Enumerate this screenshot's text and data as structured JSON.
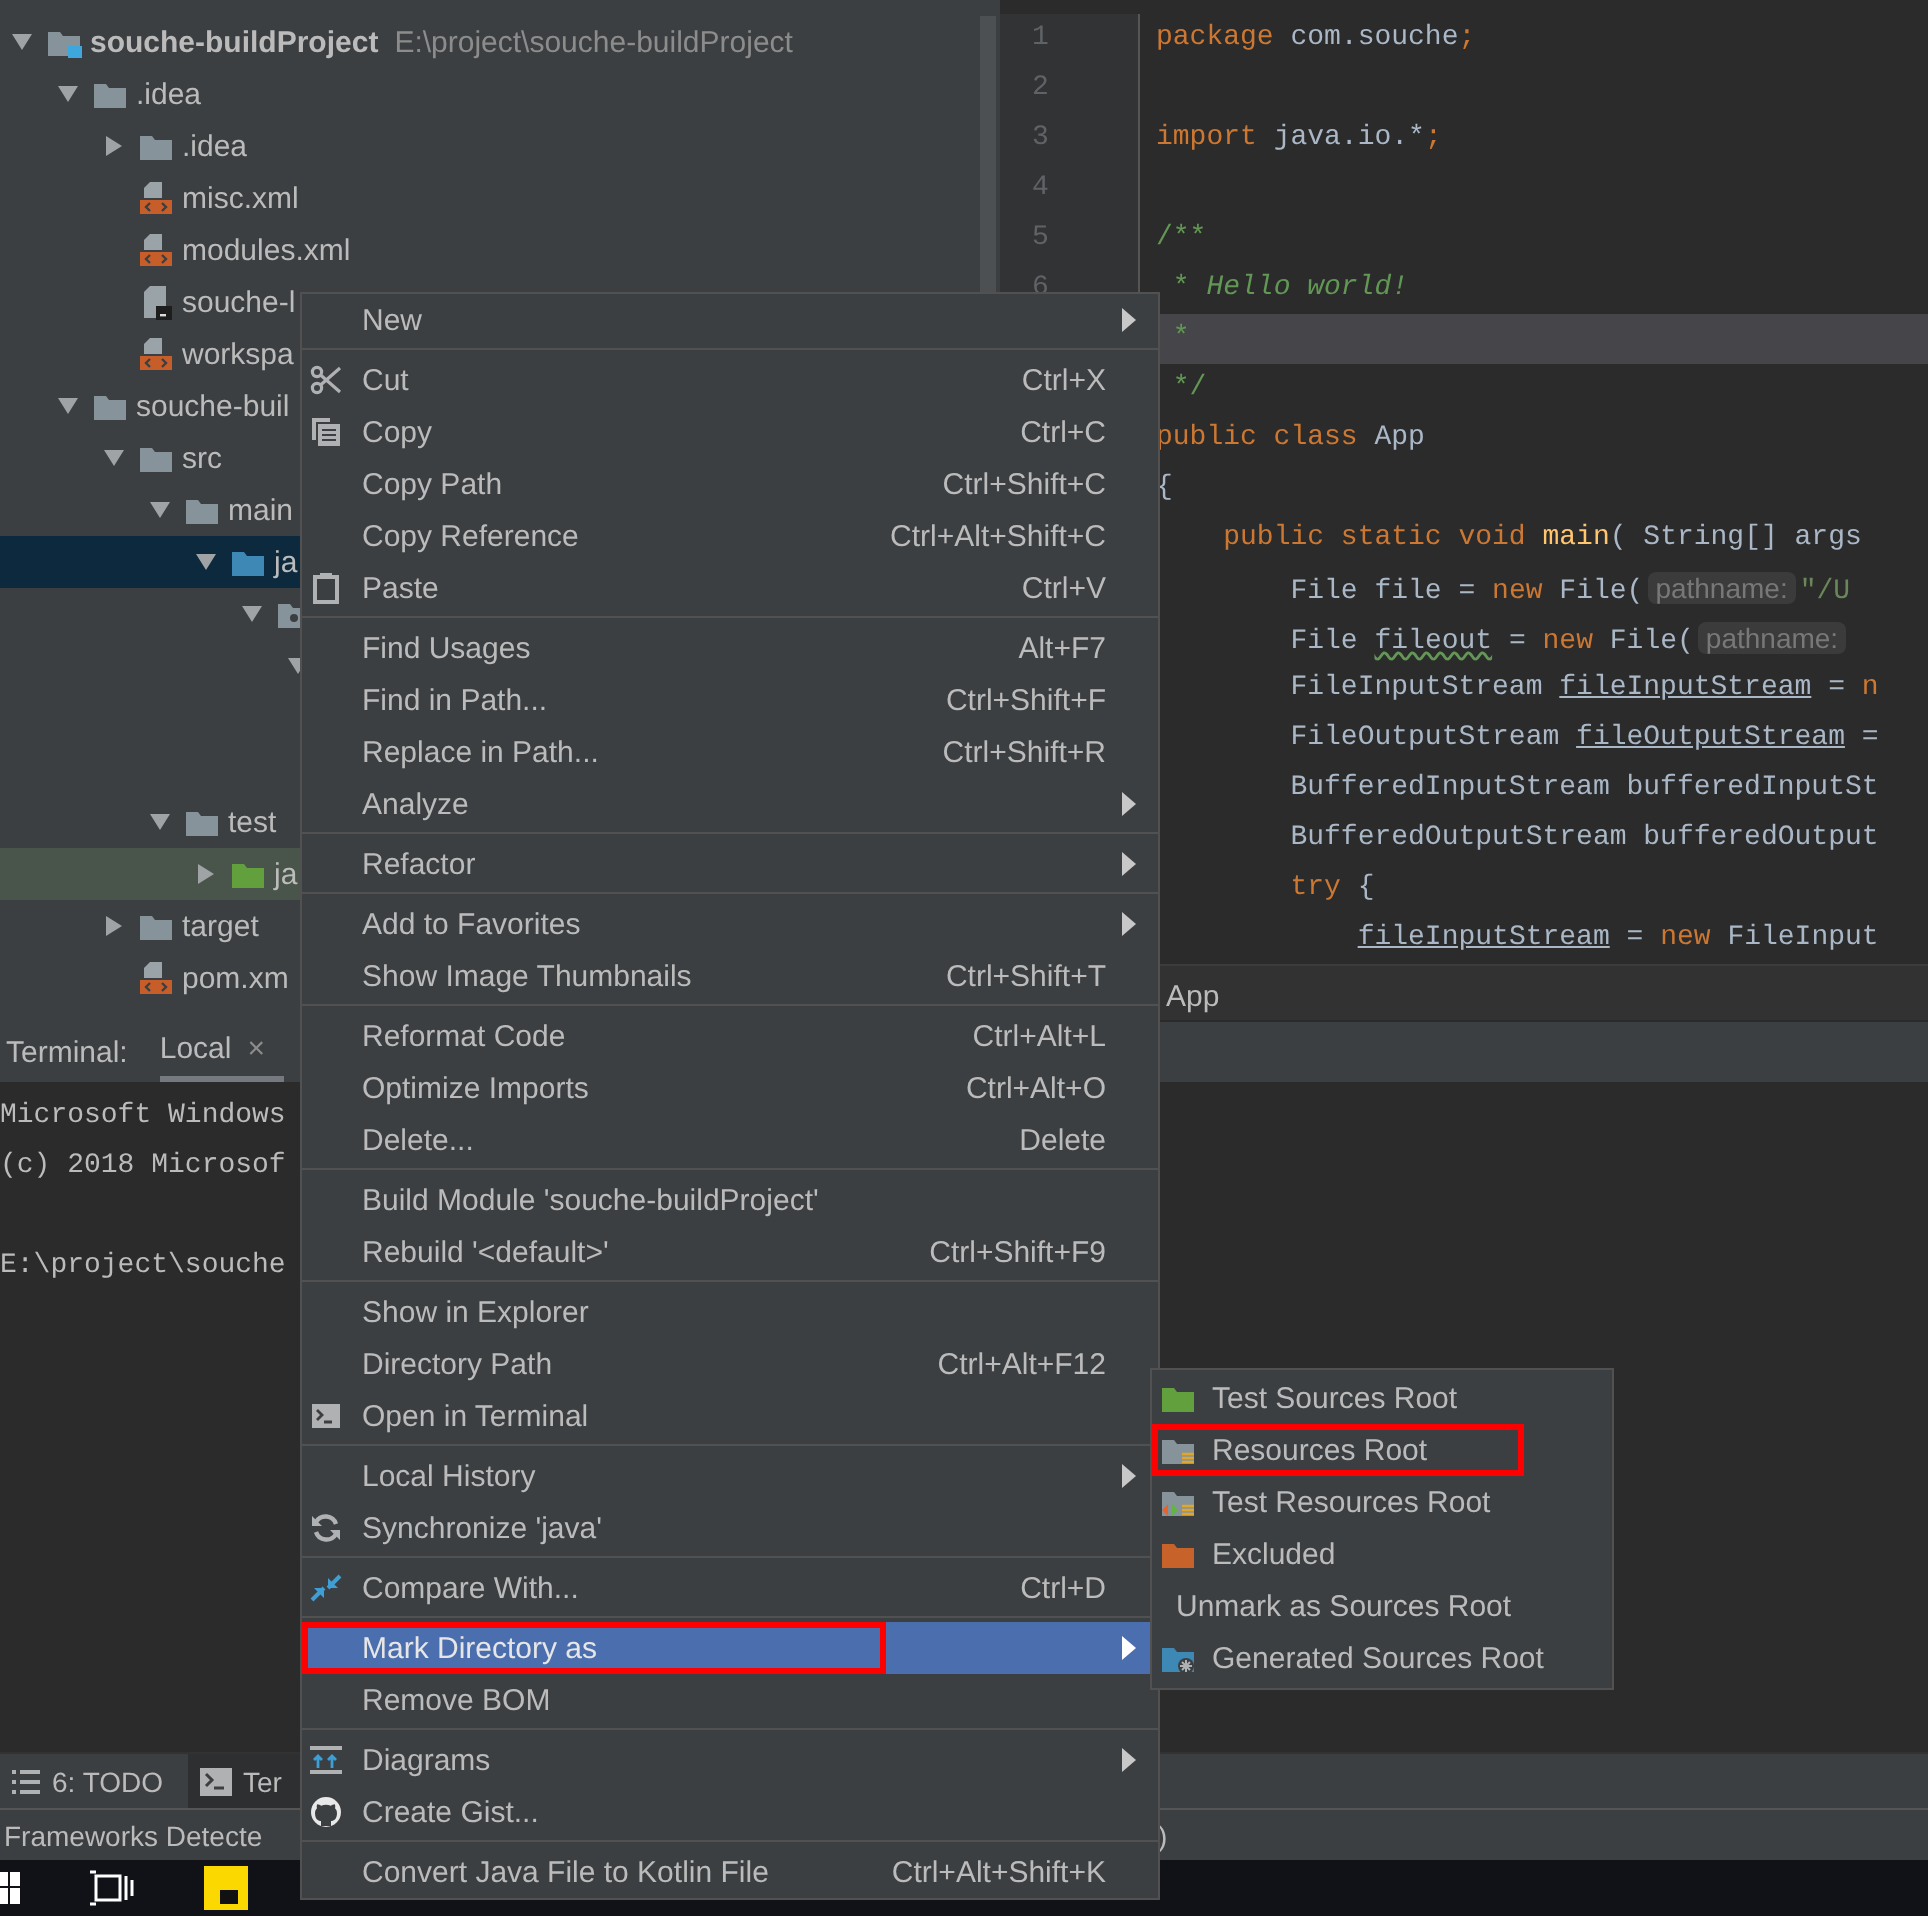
{
  "project_tree": [
    {
      "label": "souche-buildProject",
      "path": "E:\\project\\souche-buildProject",
      "kind": "module",
      "expanded": true,
      "selected": false,
      "children": [
        {
          "label": ".idea",
          "kind": "folder",
          "expanded": true,
          "selected": false,
          "children": [
            {
              "label": ".idea",
              "kind": "folder",
              "expanded": false,
              "selected": false
            },
            {
              "label": "misc.xml",
              "kind": "xml",
              "selected": false
            },
            {
              "label": "modules.xml",
              "kind": "xml",
              "selected": false
            },
            {
              "label": "souche-l",
              "kind": "iml",
              "selected": false
            },
            {
              "label": "workspa",
              "kind": "xml",
              "selected": false
            }
          ]
        },
        {
          "label": "souche-buil",
          "kind": "folder",
          "expanded": true,
          "selected": false,
          "children": [
            {
              "label": "src",
              "kind": "folder",
              "expanded": true,
              "selected": false,
              "children": [
                {
                  "label": "main",
                  "kind": "folder",
                  "expanded": true,
                  "selected": false,
                  "children": [
                    {
                      "label": "ja",
                      "kind": "sources",
                      "expanded": true,
                      "selected": true,
                      "children": [
                        {
                          "kind": "package",
                          "expanded": true,
                          "selected": false,
                          "children": [
                            {
                              "expanded": true,
                              "selected": false
                            }
                          ]
                        }
                      ]
                    }
                  ]
                },
                {
                  "label": "test",
                  "kind": "folder",
                  "expanded": true,
                  "selected": false,
                  "children": [
                    {
                      "label": "ja",
                      "kind": "test-sources",
                      "expanded": false,
                      "selected": false
                    }
                  ]
                }
              ]
            },
            {
              "label": "target",
              "kind": "folder",
              "expanded": false,
              "selected": false
            },
            {
              "label": "pom.xm",
              "kind": "xml",
              "selected": false
            }
          ]
        }
      ]
    }
  ],
  "editor": {
    "lines": [
      {
        "number": "1",
        "current": false,
        "tokens": [
          {
            "kind": "keyword",
            "text": "package"
          },
          {
            "kind": "plain",
            "text": " com.souche"
          },
          {
            "kind": "keyword",
            "text": ";"
          }
        ]
      },
      {
        "number": "2",
        "current": false
      },
      {
        "number": "3",
        "current": false,
        "tokens": [
          {
            "kind": "keyword",
            "text": "import"
          },
          {
            "kind": "plain",
            "text": " java.io.*"
          },
          {
            "kind": "keyword",
            "text": ";"
          }
        ]
      },
      {
        "number": "4",
        "current": false
      },
      {
        "number": "5",
        "current": false,
        "tokens": [
          {
            "kind": "comment",
            "text": "/**"
          }
        ]
      },
      {
        "number": "6",
        "current": false,
        "tokens": [
          {
            "kind": "comment",
            "text": " * "
          },
          {
            "kind": "doc",
            "text": "Hello world!"
          }
        ]
      },
      {
        "current": true,
        "tokens": [
          {
            "kind": "comment",
            "text": " *"
          }
        ]
      },
      {
        "current": false,
        "tokens": [
          {
            "kind": "comment",
            "text": " */"
          }
        ]
      },
      {
        "current": false,
        "tokens": [
          {
            "kind": "keyword",
            "text": "public class"
          },
          {
            "kind": "plain",
            "text": " App"
          }
        ]
      },
      {
        "current": false,
        "tokens": [
          {
            "kind": "plain",
            "text": "{"
          }
        ]
      },
      {
        "current": false,
        "tokens": [
          {
            "kind": "keyword",
            "text": "    public static void"
          },
          {
            "kind": "method",
            "text": " main"
          },
          {
            "kind": "plain",
            "text": "( String[] args"
          }
        ]
      },
      {
        "current": false,
        "tokens": [
          {
            "kind": "plain",
            "text": "        File file = "
          },
          {
            "kind": "keyword",
            "text": "new"
          },
          {
            "kind": "plain",
            "text": " File("
          },
          {
            "kind": "hint",
            "text": "pathname:"
          },
          {
            "kind": "string",
            "text": "\"/U"
          }
        ]
      },
      {
        "current": false,
        "tokens": [
          {
            "kind": "plain",
            "text": "        File "
          },
          {
            "kind": "wavy",
            "text": "fileout"
          },
          {
            "kind": "plain",
            "text": " = "
          },
          {
            "kind": "keyword",
            "text": "new"
          },
          {
            "kind": "plain",
            "text": " File("
          },
          {
            "kind": "hint",
            "text": "pathname:"
          }
        ]
      },
      {
        "current": false,
        "tokens": [
          {
            "kind": "plain",
            "text": "        FileInputStream "
          },
          {
            "kind": "underlined",
            "text": "fileInputStream"
          },
          {
            "kind": "plain",
            "text": " = "
          },
          {
            "kind": "keyword",
            "text": "n"
          }
        ]
      },
      {
        "current": false,
        "tokens": [
          {
            "kind": "plain",
            "text": "        FileOutputStream "
          },
          {
            "kind": "underlined",
            "text": "fileOutputStream"
          },
          {
            "kind": "plain",
            "text": " ="
          }
        ]
      },
      {
        "current": false,
        "tokens": [
          {
            "kind": "plain",
            "text": "        BufferedInputStream bufferedInputSt"
          }
        ]
      },
      {
        "current": false,
        "tokens": [
          {
            "kind": "plain",
            "text": "        BufferedOutputStream bufferedOutput"
          }
        ]
      },
      {
        "current": false,
        "tokens": [
          {
            "kind": "keyword",
            "text": "        try"
          },
          {
            "kind": "plain",
            "text": " {"
          }
        ]
      },
      {
        "current": false,
        "tokens": [
          {
            "kind": "underlined",
            "text": "            fileInputStream"
          },
          {
            "kind": "plain",
            "text": " = "
          },
          {
            "kind": "keyword",
            "text": "new"
          },
          {
            "kind": "plain",
            "text": " FileInput"
          }
        ]
      }
    ],
    "breadcrumb": "App"
  },
  "terminal": {
    "title": "Terminal:",
    "tabs": [
      {
        "label": "Local",
        "close": "×",
        "selected": true
      }
    ],
    "lines": [
      "Microsoft Windows",
      "(c) 2018 Microsof"
    ],
    "prompt": "E:\\project\\souche"
  },
  "tool_tabs": [
    {
      "kind": "todo",
      "label": "6: TODO",
      "selected": false
    },
    {
      "kind": "terminal",
      "label": "Ter",
      "selected": true
    }
  ],
  "status_bar": [
    "Frameworks Detecte",
    ")"
  ],
  "context_menu": {
    "sections": [
      [
        {
          "label": "New",
          "kind": "plain",
          "submenu": true,
          "selected": false,
          "outlined": false
        }
      ],
      [
        {
          "label": "Cut",
          "kind": "cut",
          "shortcut": "Ctrl+X",
          "submenu": false,
          "selected": false,
          "outlined": false
        },
        {
          "label": "Copy",
          "kind": "copy",
          "shortcut": "Ctrl+C",
          "submenu": false,
          "selected": false,
          "outlined": false
        },
        {
          "label": "Copy Path",
          "kind": "plain",
          "shortcut": "Ctrl+Shift+C",
          "submenu": false,
          "selected": false,
          "outlined": false
        },
        {
          "label": "Copy Reference",
          "kind": "plain",
          "shortcut": "Ctrl+Alt+Shift+C",
          "submenu": false,
          "selected": false,
          "outlined": false
        },
        {
          "label": "Paste",
          "kind": "paste",
          "shortcut": "Ctrl+V",
          "submenu": false,
          "selected": false,
          "outlined": false
        }
      ],
      [
        {
          "label": "Find Usages",
          "kind": "plain",
          "shortcut": "Alt+F7",
          "submenu": false,
          "selected": false,
          "outlined": false
        },
        {
          "label": "Find in Path...",
          "kind": "plain",
          "shortcut": "Ctrl+Shift+F",
          "submenu": false,
          "selected": false,
          "outlined": false
        },
        {
          "label": "Replace in Path...",
          "kind": "plain",
          "shortcut": "Ctrl+Shift+R",
          "submenu": false,
          "selected": false,
          "outlined": false
        },
        {
          "label": "Analyze",
          "kind": "plain",
          "submenu": true,
          "selected": false,
          "outlined": false
        }
      ],
      [
        {
          "label": "Refactor",
          "kind": "plain",
          "submenu": true,
          "selected": false,
          "outlined": false
        }
      ],
      [
        {
          "label": "Add to Favorites",
          "kind": "plain",
          "submenu": true,
          "selected": false,
          "outlined": false
        },
        {
          "label": "Show Image Thumbnails",
          "kind": "plain",
          "shortcut": "Ctrl+Shift+T",
          "submenu": false,
          "selected": false,
          "outlined": false
        }
      ],
      [
        {
          "label": "Reformat Code",
          "kind": "plain",
          "shortcut": "Ctrl+Alt+L",
          "submenu": false,
          "selected": false,
          "outlined": false
        },
        {
          "label": "Optimize Imports",
          "kind": "plain",
          "shortcut": "Ctrl+Alt+O",
          "submenu": false,
          "selected": false,
          "outlined": false
        },
        {
          "label": "Delete...",
          "kind": "plain",
          "shortcut": "Delete",
          "submenu": false,
          "selected": false,
          "outlined": false
        }
      ],
      [
        {
          "label": "Build Module 'souche-buildProject'",
          "kind": "plain",
          "submenu": false,
          "selected": false,
          "outlined": false
        },
        {
          "label": "Rebuild '<default>'",
          "kind": "plain",
          "shortcut": "Ctrl+Shift+F9",
          "submenu": false,
          "selected": false,
          "outlined": false
        }
      ],
      [
        {
          "label": "Show in Explorer",
          "kind": "plain",
          "submenu": false,
          "selected": false,
          "outlined": false
        },
        {
          "label": "Directory Path",
          "kind": "plain",
          "shortcut": "Ctrl+Alt+F12",
          "submenu": false,
          "selected": false,
          "outlined": false
        },
        {
          "label": "Open in Terminal",
          "kind": "terminal",
          "submenu": false,
          "selected": false,
          "outlined": false
        }
      ],
      [
        {
          "label": "Local History",
          "kind": "plain",
          "submenu": true,
          "selected": false,
          "outlined": false
        },
        {
          "label": "Synchronize 'java'",
          "kind": "sync",
          "submenu": false,
          "selected": false,
          "outlined": false
        }
      ],
      [
        {
          "label": "Compare With...",
          "kind": "compare",
          "shortcut": "Ctrl+D",
          "submenu": false,
          "selected": false,
          "outlined": false
        }
      ],
      [
        {
          "label": "Mark Directory as",
          "kind": "plain",
          "submenu": true,
          "selected": true,
          "outlined": true
        },
        {
          "label": "Remove BOM",
          "kind": "plain",
          "submenu": false,
          "selected": false,
          "outlined": false
        }
      ],
      [
        {
          "label": "Diagrams",
          "kind": "diagrams",
          "submenu": true,
          "selected": false,
          "outlined": false
        },
        {
          "label": "Create Gist...",
          "kind": "gist",
          "submenu": false,
          "selected": false,
          "outlined": false
        }
      ],
      [
        {
          "label": "Convert Java File to Kotlin File",
          "kind": "plain",
          "shortcut": "Ctrl+Alt+Shift+K",
          "submenu": false,
          "selected": false,
          "outlined": false
        }
      ]
    ]
  },
  "submenu": [
    {
      "label": "Test Sources Root",
      "kind": "test-sources",
      "outlined": false
    },
    {
      "label": "Resources Root",
      "kind": "resources",
      "outlined": true
    },
    {
      "label": "Test Resources Root",
      "kind": "test-resources",
      "outlined": false
    },
    {
      "label": "Excluded",
      "kind": "excluded",
      "outlined": false
    },
    {
      "label": "Unmark as Sources Root",
      "kind": "plain",
      "outlined": false
    },
    {
      "label": "Generated Sources Root",
      "kind": "generated",
      "outlined": false
    }
  ]
}
